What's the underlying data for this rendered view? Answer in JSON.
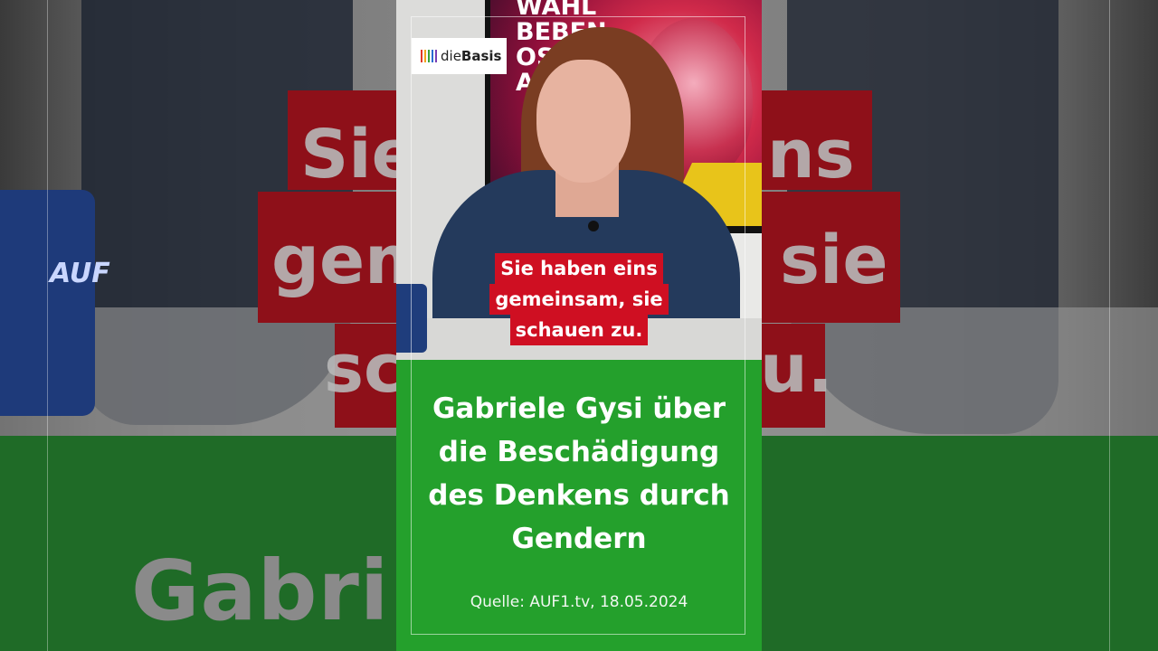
{
  "logo": {
    "prefix": "die",
    "name": "Basis",
    "bar_colors": [
      "#e23a2a",
      "#f2a51c",
      "#3aa33a",
      "#2a6bd1",
      "#7a3fb5"
    ]
  },
  "tv": {
    "lines": [
      "WAHL",
      "BEBEN",
      "OS",
      "A"
    ]
  },
  "caption": {
    "lines": [
      "Sie haben eins",
      "gemeinsam, sie",
      "schauen zu."
    ]
  },
  "background": {
    "words": [
      "Sie",
      "ns",
      "gem",
      "sie",
      "sc",
      "u."
    ],
    "green_text": "Gabri        si über"
  },
  "title": {
    "lines": [
      "Gabriele Gysi über",
      "die Beschädigung",
      "des Denkens durch",
      "Gendern"
    ]
  },
  "source": "Quelle: AUF1.tv, 18.05.2024",
  "mug_text": "AUF",
  "colors": {
    "green": "#24a02c",
    "red": "#cf0f22",
    "white": "#ffffff"
  }
}
